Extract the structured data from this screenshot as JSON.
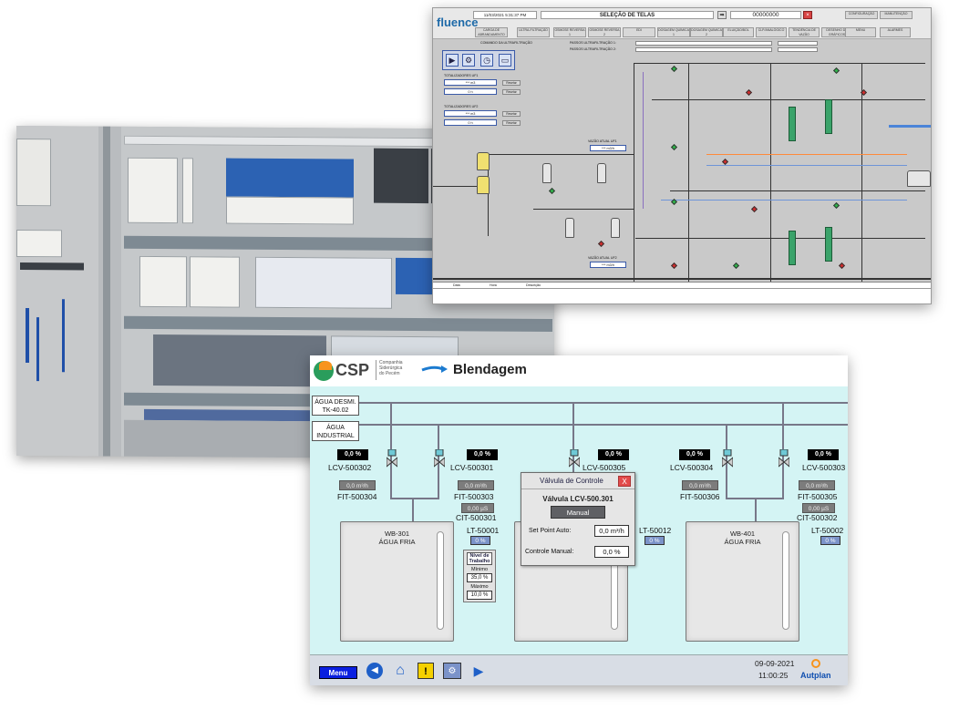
{
  "scada": {
    "brand": "fluence",
    "datetime": "11/03/2021 5:31:37 PM",
    "screen_title": "SELEÇÃO DE TELAS",
    "counter_value": "00000000",
    "nav_left": [
      "CARGA DE ABRANDAMENTO",
      "ULTRA-FILTRAÇÃO",
      "OSMOSE REVERSA 1",
      "OSMOSE REVERSA 2",
      "EDI",
      "DOSAGEM QUÍMICA 1",
      "DOSAGEM QUÍMICA 2"
    ],
    "nav_right_top": [
      "CONFIGURAÇÃO",
      "MANUTENÇÃO"
    ],
    "nav_right_bottom": [
      "ELUIÇÃO/BOL",
      "CLP/ANALÓGICO",
      "TENDÊNCIA DE VAZÃO",
      "DESENHO DE GRÁFICOS",
      "MENU",
      "ALARMES"
    ],
    "command_label": "COMANDO DA ULTRAFILTRAÇÃO",
    "totalizer_1": "TOTALIZADORES UF1",
    "totalizer_2": "TOTALIZADORES UF2",
    "field_values": [
      "*** m3",
      "0 h",
      "*** m3",
      "0 h"
    ],
    "reset_label": "Resetar",
    "passos_1": "PASSOS ULTRAFILTRAÇÃO 1:",
    "passos_2": "PASSOS ULTRAFILTRAÇÃO 2:",
    "flow_labels": [
      "VAZÃO ATUAL UF1",
      "VAZÃO ATUAL UF2"
    ],
    "flow_values": [
      "*** m3/h",
      "*** m3/h"
    ],
    "columns": [
      "Data",
      "Hora",
      "Descrição"
    ]
  },
  "hmi": {
    "logo_text": "CSP",
    "logo_sub": [
      "Companhia",
      "Siderúrgica",
      "do Pecém"
    ],
    "title": "Blendagem",
    "sources": [
      "ÁGUA DESMI.\nTK-40.02",
      "ÁGUA\nINDUSTRIAL"
    ],
    "pct_values": [
      "0,0 %",
      "0,0 %",
      "0,0 %",
      "0,0 %",
      "0,0 %"
    ],
    "valves": [
      "LCV-500302",
      "LCV-500301",
      "LCV-500305",
      "LCV-500304",
      "LCV-500303"
    ],
    "fit_values": [
      "0,0 m³/h",
      "0,0 m³/h",
      "0,0 m³/h",
      "0,0 m³/h"
    ],
    "fits": [
      "FIT-500304",
      "FIT-500303",
      "FIT-500306",
      "FIT-500305"
    ],
    "cit_values": [
      "0,00 µS",
      "0,00 µS"
    ],
    "cits": [
      "CIT-500301",
      "CIT-500302"
    ],
    "tanks": [
      {
        "name": "WB-301\nÁGUA FRIA"
      },
      {
        "name": ""
      },
      {
        "name": "WB-401\nÁGUA FRIA"
      }
    ],
    "levels": [
      {
        "tag": "LT-50001",
        "value": "0 %"
      },
      {
        "tag": "LT-50012",
        "value": "0 %"
      },
      {
        "tag": "LT-50002",
        "value": "0 %"
      }
    ],
    "trabalho": {
      "title": "Nível de Trabalho",
      "min_label": "Mínimo",
      "min_value": "35,0 %",
      "max_label": "Máximo",
      "max_value": "10,0 %"
    },
    "dialog": {
      "title": "Válvula de Controle",
      "close": "X",
      "valve_label": "Válvula LCV-500.301",
      "mode_button": "Manual",
      "setpoint_label": "Set Point Auto:",
      "setpoint_value": "0,0 m³/h",
      "manual_label": "Controle Manual:",
      "manual_value": "0,0 %"
    },
    "menu_button": "Menu",
    "date": "09-09-2021",
    "time": "11:00:25",
    "brand": "Autplan"
  }
}
